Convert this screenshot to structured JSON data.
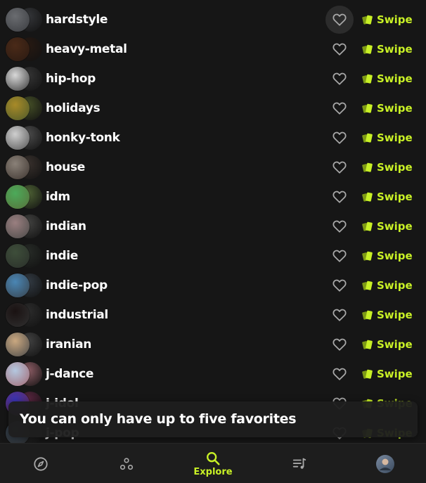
{
  "genres": [
    {
      "name": "hardstyle",
      "favorited": false,
      "highlighted": true,
      "colors": [
        "#6a6c70",
        "#3a3c40"
      ]
    },
    {
      "name": "heavy-metal",
      "favorited": false,
      "highlighted": false,
      "colors": [
        "#4a2a18",
        "#2a1a12"
      ]
    },
    {
      "name": "hip-hop",
      "favorited": false,
      "highlighted": false,
      "colors": [
        "#d8d8d8",
        "#3a3a3a"
      ]
    },
    {
      "name": "holidays",
      "favorited": false,
      "highlighted": false,
      "colors": [
        "#a88a28",
        "#4e5a2a"
      ]
    },
    {
      "name": "honky-tonk",
      "favorited": false,
      "highlighted": false,
      "colors": [
        "#cfcfcf",
        "#555555"
      ]
    },
    {
      "name": "house",
      "favorited": false,
      "highlighted": false,
      "colors": [
        "#8a8178",
        "#3e3530"
      ]
    },
    {
      "name": "idm",
      "favorited": false,
      "highlighted": false,
      "colors": [
        "#4caa5a",
        "#58703a"
      ]
    },
    {
      "name": "indian",
      "favorited": false,
      "highlighted": false,
      "colors": [
        "#9a7f80",
        "#4a4a48"
      ]
    },
    {
      "name": "indie",
      "favorited": false,
      "highlighted": false,
      "colors": [
        "#3e4e3a",
        "#2a2f2a"
      ]
    },
    {
      "name": "indie-pop",
      "favorited": false,
      "highlighted": false,
      "colors": [
        "#4a86b4",
        "#38424c"
      ]
    },
    {
      "name": "industrial",
      "favorited": false,
      "highlighted": false,
      "colors": [
        "#1a1212",
        "#303030"
      ]
    },
    {
      "name": "iranian",
      "favorited": false,
      "highlighted": false,
      "colors": [
        "#caa880",
        "#4a4a4a"
      ]
    },
    {
      "name": "j-dance",
      "favorited": false,
      "highlighted": false,
      "colors": [
        "#b4c8e0",
        "#a46a74"
      ]
    },
    {
      "name": "j-idol",
      "favorited": false,
      "highlighted": false,
      "colors": [
        "#3a34b8",
        "#6a2a4a"
      ]
    },
    {
      "name": "j-pop",
      "favorited": false,
      "highlighted": false,
      "colors": [
        "#3a4a5a",
        "#2a2a2a"
      ]
    }
  ],
  "row_labels": {
    "swipe": "Swipe"
  },
  "icons": {
    "favorite": "heart-outline-icon",
    "swipe": "cards-icon"
  },
  "toast": {
    "message": "You can only have up to five favorites"
  },
  "nav": {
    "items": [
      {
        "id": "discover",
        "icon": "compass-icon",
        "label": "",
        "active": false
      },
      {
        "id": "artists",
        "icon": "circles-icon",
        "label": "",
        "active": false
      },
      {
        "id": "explore",
        "icon": "search-icon",
        "label": "Explore",
        "active": true
      },
      {
        "id": "playlists",
        "icon": "playlist-icon",
        "label": "",
        "active": false
      },
      {
        "id": "profile",
        "icon": "avatar",
        "label": "",
        "active": false
      }
    ]
  },
  "colors": {
    "accent": "#c8f026",
    "background": "#161616",
    "nav_background": "#1d1d1d",
    "text": "#ffffff",
    "icon": "#a8a8a8"
  }
}
